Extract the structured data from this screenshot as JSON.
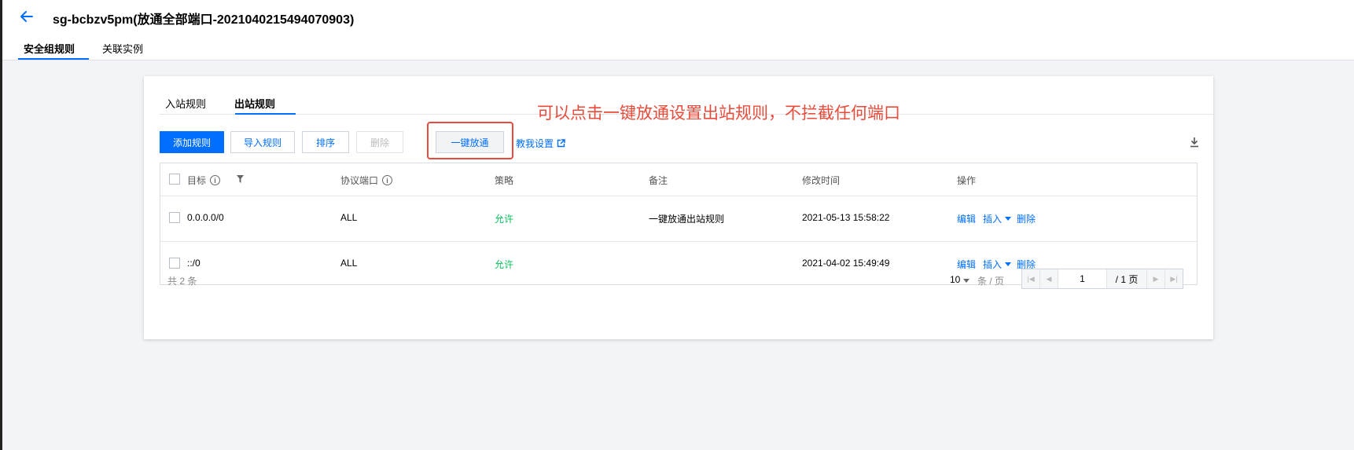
{
  "header": {
    "title": "sg-bcbzv5pm(放通全部端口-2021040215494070903)",
    "tabs": [
      {
        "label": "安全组规则",
        "active": true
      },
      {
        "label": "关联实例",
        "active": false
      }
    ]
  },
  "subtabs": [
    {
      "label": "入站规则",
      "active": false
    },
    {
      "label": "出站规则",
      "active": true
    }
  ],
  "toolbar": {
    "add_label": "添加规则",
    "import_label": "导入规则",
    "sort_label": "排序",
    "delete_label": "删除",
    "one_click_label": "一键放通",
    "guide_label": "教我设置"
  },
  "annotation": "可以点击一键放通设置出站规则，不拦截任何端口",
  "table": {
    "columns": {
      "target": "目标",
      "protocol_port": "协议端口",
      "policy": "策略",
      "remark": "备注",
      "modified": "修改时间",
      "actions": "操作"
    },
    "rows": [
      {
        "target": "0.0.0.0/0",
        "protocol_port": "ALL",
        "policy": "允许",
        "remark": "一键放通出站规则",
        "modified": "2021-05-13 15:58:22",
        "edit": "编辑",
        "insert": "插入",
        "delete": "删除"
      },
      {
        "target": "::/0",
        "protocol_port": "ALL",
        "policy": "允许",
        "remark": "",
        "modified": "2021-04-02 15:49:49",
        "edit": "编辑",
        "insert": "插入",
        "delete": "删除"
      }
    ]
  },
  "pagination": {
    "total_text": "共 2 条",
    "page_size": "10",
    "per_page_text": "条 / 页",
    "current_page": "1",
    "total_pages_text": "/ 1 页"
  },
  "colors": {
    "accent": "#006eff",
    "allow": "#0abf5b",
    "annotation": "#e94b3b"
  }
}
